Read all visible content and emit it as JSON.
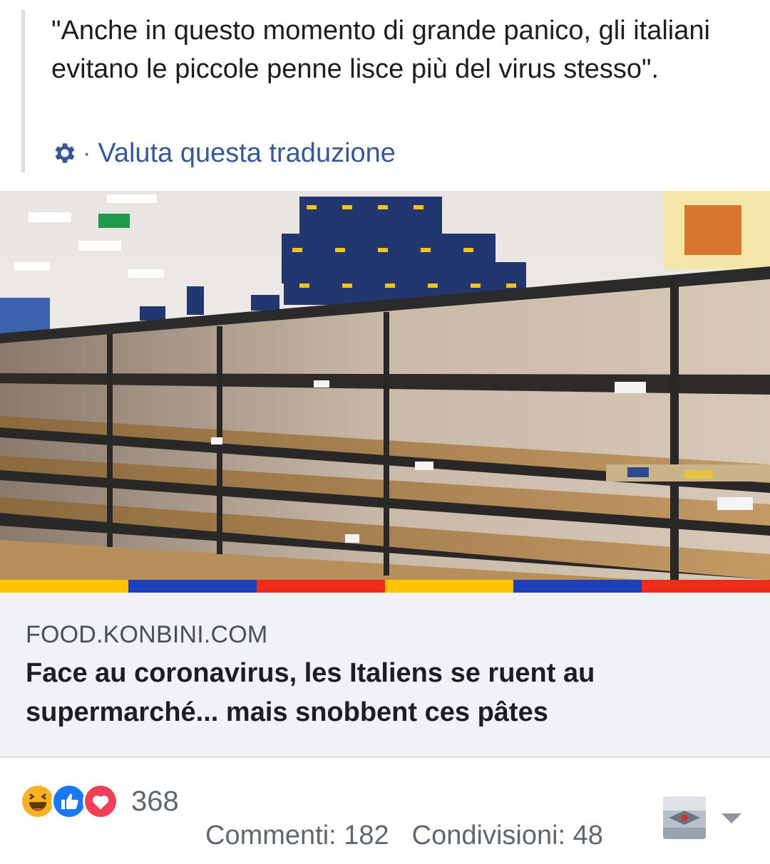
{
  "translation": {
    "text": "\"Anche in questo momento di grande panico, gli italiani evitano le piccole penne lisce più del virus stesso\".",
    "separator": "·",
    "rate_link": "Valuta questa traduzione",
    "gear_icon": "gear-icon"
  },
  "link_preview": {
    "image_icon": "photo-empty-supermarket-shelves",
    "strip_colors": [
      "#fcc400",
      "#1d3fbc",
      "#ef2b1a",
      "#fcc400",
      "#1d3fbc",
      "#ef2b1a"
    ],
    "domain": "FOOD.KONBINI.COM",
    "headline": "Face au coronavirus, les Italiens se ruent au supermarché... mais snobbent ces pâtes"
  },
  "footer": {
    "reactions": [
      "haha-icon",
      "like-icon",
      "love-icon"
    ],
    "reaction_count": "368",
    "comments": "Commenti: 182",
    "shares": "Condivisioni: 48",
    "avatar_icon": "avatar-thumbnail",
    "menu_icon": "caret-down-icon"
  },
  "colors": {
    "link": "#385898",
    "caption_bg": "#f0f2f5",
    "secondary_text": "#606770",
    "like": "#1877f2",
    "love": "#f33e58",
    "haha": "#f7b125"
  }
}
